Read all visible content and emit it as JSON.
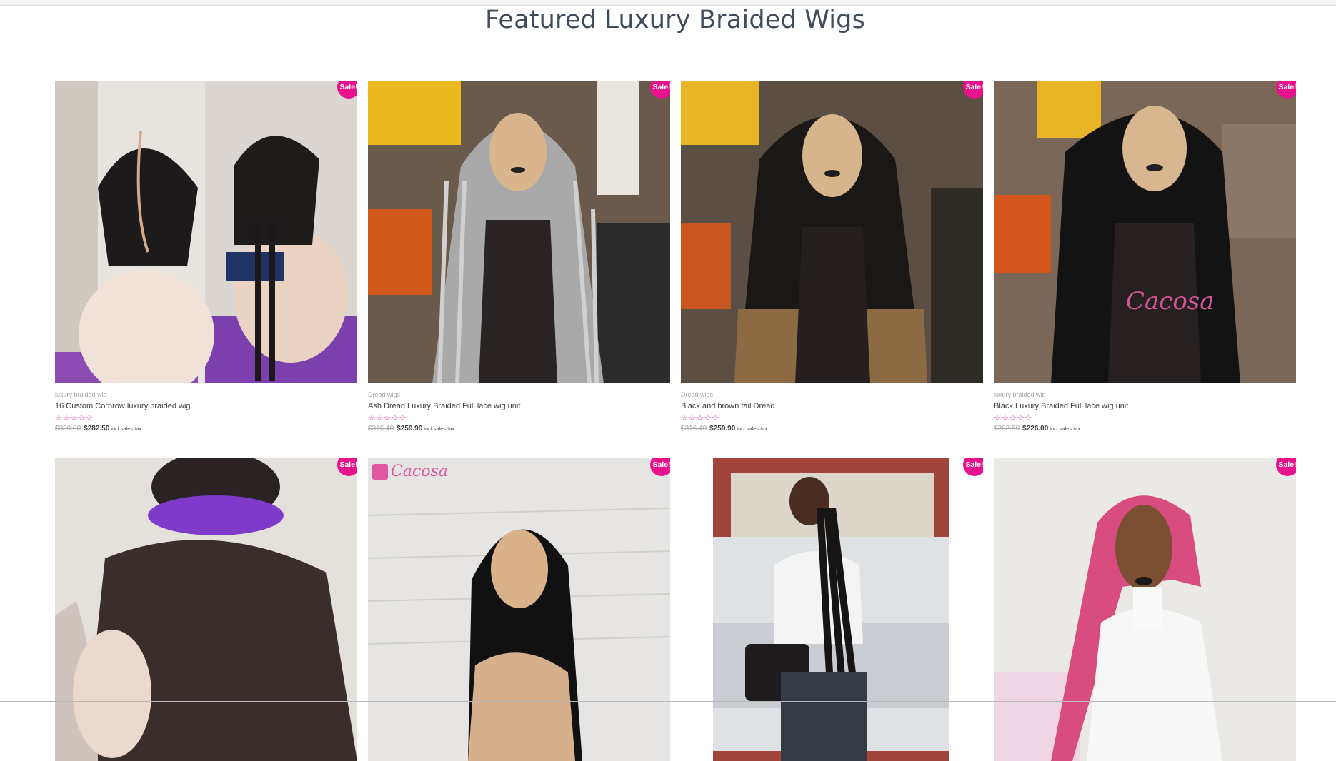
{
  "section": {
    "title": "Featured Luxury Braided Wigs"
  },
  "badge_label": "Sale!",
  "currency_note": "incl sales tax",
  "accent_color": "#e8138c",
  "products": [
    {
      "category": "luxury braided wig",
      "name": "16 Custom Cornrow luxury braided wig",
      "rating_stars": 5,
      "old_price": "$339.00",
      "new_price": "$282.50",
      "image": "cornrow-wig-two-mannequins"
    },
    {
      "category": "Dread wigs",
      "name": "Ash Dread Luxury Braided Full lace wig unit",
      "rating_stars": 5,
      "old_price": "$316.40",
      "new_price": "$259.90",
      "image": "ash-grey-dread-wig-mannequin"
    },
    {
      "category": "Dread wigs",
      "name": "Black and brown tail Dread",
      "rating_stars": 5,
      "old_price": "$316.40",
      "new_price": "$259.90",
      "image": "black-brown-dread-wig-mannequin"
    },
    {
      "category": "luxury braided wig",
      "name": "Black Luxury Braided Full lace wig unit",
      "rating_stars": 5,
      "old_price": "$282.50",
      "new_price": "$226.00",
      "image": "black-box-braid-wig-mannequin"
    },
    {
      "image": "purple-bun-braided-wig-side"
    },
    {
      "image": "straight-black-wig-mannequin",
      "logo_text": "Cacosa"
    },
    {
      "image": "woman-long-braids-car"
    },
    {
      "image": "pink-cornrow-wig-mannequin"
    }
  ]
}
